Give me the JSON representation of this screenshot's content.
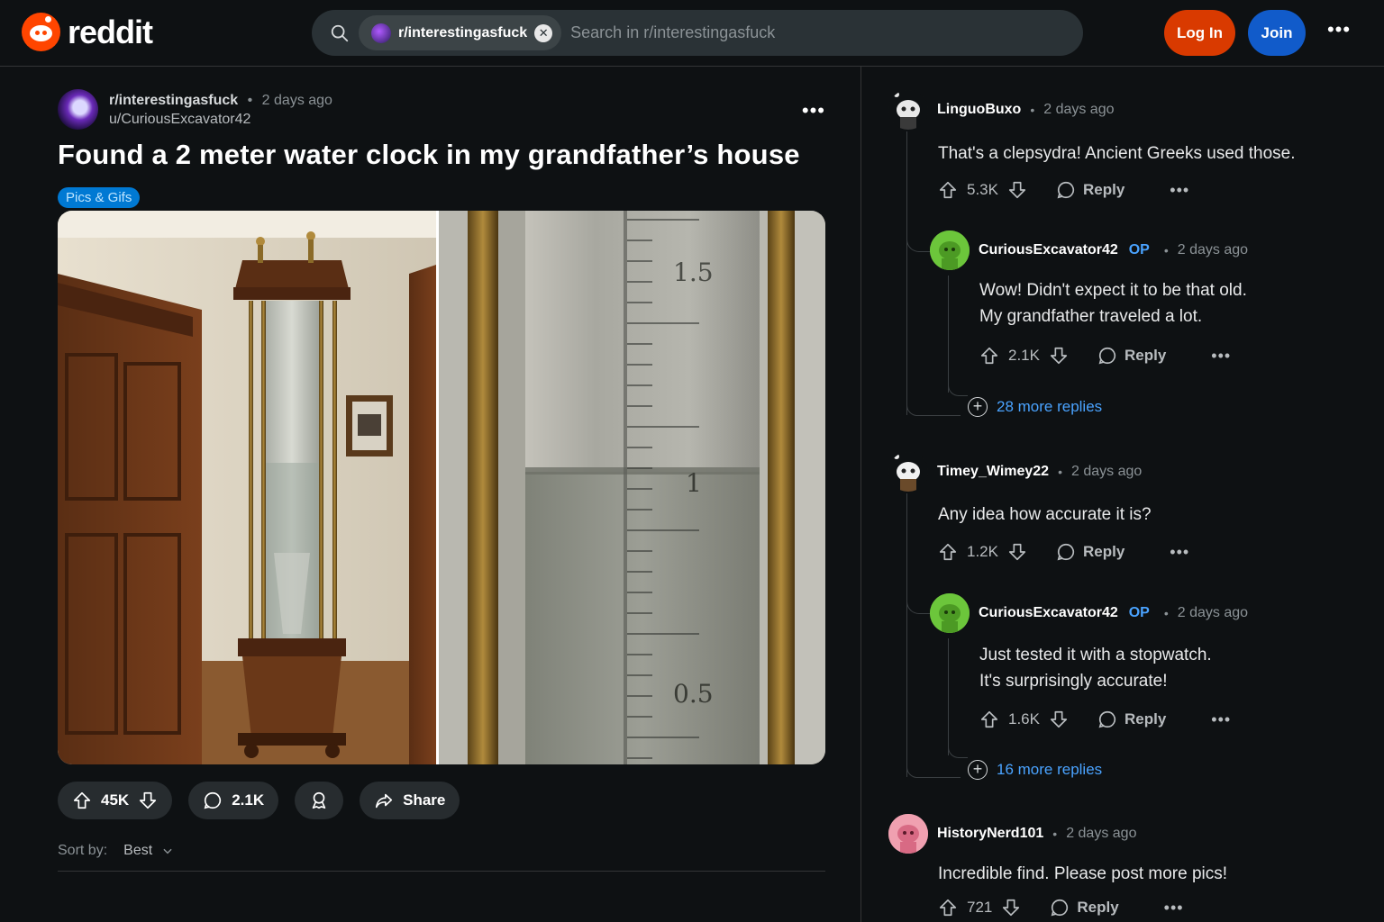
{
  "app": {
    "logo_text": "reddit",
    "brand_color": "#ff4500"
  },
  "search": {
    "chip_label": "r/interestingasfuck",
    "placeholder": "Search in r/interestingasfuck"
  },
  "header": {
    "login_label": "Log In",
    "join_label": "Join",
    "more_label": "•••"
  },
  "post": {
    "subreddit": "r/interestingasfuck",
    "time": "2 days ago",
    "author": "u/CuriousExcavator42",
    "title": "Found a 2 meter water clock in my grandfather’s house",
    "flair": "Pics & Gifs",
    "image_labels": {
      "mark_high": "1.5",
      "mark_mid": "1",
      "mark_low": "0.5"
    },
    "upvotes": "45K",
    "comments": "2.1K",
    "share_label": "Share",
    "more_label": "•••"
  },
  "sort": {
    "label": "Sort by:",
    "value": "Best"
  },
  "comments": [
    {
      "user": "LinguoBuxo",
      "time": "2 days ago",
      "body": "That's a clepsydra! Ancient Greeks used those.",
      "votes": "5.3K",
      "reply": "Reply"
    },
    {
      "user": "CuriousExcavator42",
      "op": "OP",
      "time": "2 days ago",
      "body_1": "Wow! Didn't expect it to be that old.",
      "body_2": "My grandfather traveled a lot.",
      "votes": "2.1K",
      "reply": "Reply",
      "more_replies": "28 more replies"
    },
    {
      "user": "Timey_Wimey22",
      "time": "2 days ago",
      "body": "Any idea how accurate it is?",
      "votes": "1.2K",
      "reply": "Reply"
    },
    {
      "user": "CuriousExcavator42",
      "op": "OP",
      "time": "2 days ago",
      "body_1": "Just tested it with a stopwatch.",
      "body_2": "It's surprisingly accurate!",
      "votes": "1.6K",
      "reply": "Reply",
      "more_replies": "16 more replies"
    },
    {
      "user": "HistoryNerd101",
      "time": "2 days ago",
      "body": "Incredible find. Please post more pics!",
      "votes": "721",
      "reply": "Reply"
    }
  ],
  "dot": "•",
  "more": "•••"
}
